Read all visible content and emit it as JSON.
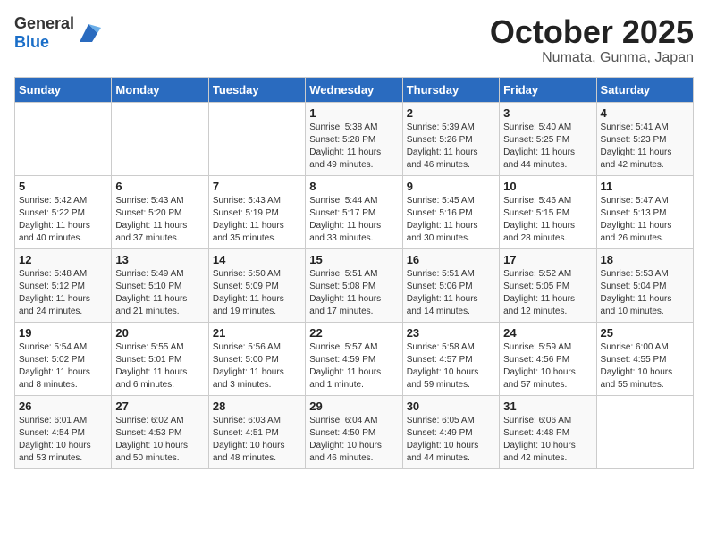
{
  "header": {
    "logo_general": "General",
    "logo_blue": "Blue",
    "month": "October 2025",
    "location": "Numata, Gunma, Japan"
  },
  "weekdays": [
    "Sunday",
    "Monday",
    "Tuesday",
    "Wednesday",
    "Thursday",
    "Friday",
    "Saturday"
  ],
  "weeks": [
    [
      {
        "day": "",
        "info": ""
      },
      {
        "day": "",
        "info": ""
      },
      {
        "day": "",
        "info": ""
      },
      {
        "day": "1",
        "info": "Sunrise: 5:38 AM\nSunset: 5:28 PM\nDaylight: 11 hours\nand 49 minutes."
      },
      {
        "day": "2",
        "info": "Sunrise: 5:39 AM\nSunset: 5:26 PM\nDaylight: 11 hours\nand 46 minutes."
      },
      {
        "day": "3",
        "info": "Sunrise: 5:40 AM\nSunset: 5:25 PM\nDaylight: 11 hours\nand 44 minutes."
      },
      {
        "day": "4",
        "info": "Sunrise: 5:41 AM\nSunset: 5:23 PM\nDaylight: 11 hours\nand 42 minutes."
      }
    ],
    [
      {
        "day": "5",
        "info": "Sunrise: 5:42 AM\nSunset: 5:22 PM\nDaylight: 11 hours\nand 40 minutes."
      },
      {
        "day": "6",
        "info": "Sunrise: 5:43 AM\nSunset: 5:20 PM\nDaylight: 11 hours\nand 37 minutes."
      },
      {
        "day": "7",
        "info": "Sunrise: 5:43 AM\nSunset: 5:19 PM\nDaylight: 11 hours\nand 35 minutes."
      },
      {
        "day": "8",
        "info": "Sunrise: 5:44 AM\nSunset: 5:17 PM\nDaylight: 11 hours\nand 33 minutes."
      },
      {
        "day": "9",
        "info": "Sunrise: 5:45 AM\nSunset: 5:16 PM\nDaylight: 11 hours\nand 30 minutes."
      },
      {
        "day": "10",
        "info": "Sunrise: 5:46 AM\nSunset: 5:15 PM\nDaylight: 11 hours\nand 28 minutes."
      },
      {
        "day": "11",
        "info": "Sunrise: 5:47 AM\nSunset: 5:13 PM\nDaylight: 11 hours\nand 26 minutes."
      }
    ],
    [
      {
        "day": "12",
        "info": "Sunrise: 5:48 AM\nSunset: 5:12 PM\nDaylight: 11 hours\nand 24 minutes."
      },
      {
        "day": "13",
        "info": "Sunrise: 5:49 AM\nSunset: 5:10 PM\nDaylight: 11 hours\nand 21 minutes."
      },
      {
        "day": "14",
        "info": "Sunrise: 5:50 AM\nSunset: 5:09 PM\nDaylight: 11 hours\nand 19 minutes."
      },
      {
        "day": "15",
        "info": "Sunrise: 5:51 AM\nSunset: 5:08 PM\nDaylight: 11 hours\nand 17 minutes."
      },
      {
        "day": "16",
        "info": "Sunrise: 5:51 AM\nSunset: 5:06 PM\nDaylight: 11 hours\nand 14 minutes."
      },
      {
        "day": "17",
        "info": "Sunrise: 5:52 AM\nSunset: 5:05 PM\nDaylight: 11 hours\nand 12 minutes."
      },
      {
        "day": "18",
        "info": "Sunrise: 5:53 AM\nSunset: 5:04 PM\nDaylight: 11 hours\nand 10 minutes."
      }
    ],
    [
      {
        "day": "19",
        "info": "Sunrise: 5:54 AM\nSunset: 5:02 PM\nDaylight: 11 hours\nand 8 minutes."
      },
      {
        "day": "20",
        "info": "Sunrise: 5:55 AM\nSunset: 5:01 PM\nDaylight: 11 hours\nand 6 minutes."
      },
      {
        "day": "21",
        "info": "Sunrise: 5:56 AM\nSunset: 5:00 PM\nDaylight: 11 hours\nand 3 minutes."
      },
      {
        "day": "22",
        "info": "Sunrise: 5:57 AM\nSunset: 4:59 PM\nDaylight: 11 hours\nand 1 minute."
      },
      {
        "day": "23",
        "info": "Sunrise: 5:58 AM\nSunset: 4:57 PM\nDaylight: 10 hours\nand 59 minutes."
      },
      {
        "day": "24",
        "info": "Sunrise: 5:59 AM\nSunset: 4:56 PM\nDaylight: 10 hours\nand 57 minutes."
      },
      {
        "day": "25",
        "info": "Sunrise: 6:00 AM\nSunset: 4:55 PM\nDaylight: 10 hours\nand 55 minutes."
      }
    ],
    [
      {
        "day": "26",
        "info": "Sunrise: 6:01 AM\nSunset: 4:54 PM\nDaylight: 10 hours\nand 53 minutes."
      },
      {
        "day": "27",
        "info": "Sunrise: 6:02 AM\nSunset: 4:53 PM\nDaylight: 10 hours\nand 50 minutes."
      },
      {
        "day": "28",
        "info": "Sunrise: 6:03 AM\nSunset: 4:51 PM\nDaylight: 10 hours\nand 48 minutes."
      },
      {
        "day": "29",
        "info": "Sunrise: 6:04 AM\nSunset: 4:50 PM\nDaylight: 10 hours\nand 46 minutes."
      },
      {
        "day": "30",
        "info": "Sunrise: 6:05 AM\nSunset: 4:49 PM\nDaylight: 10 hours\nand 44 minutes."
      },
      {
        "day": "31",
        "info": "Sunrise: 6:06 AM\nSunset: 4:48 PM\nDaylight: 10 hours\nand 42 minutes."
      },
      {
        "day": "",
        "info": ""
      }
    ]
  ]
}
